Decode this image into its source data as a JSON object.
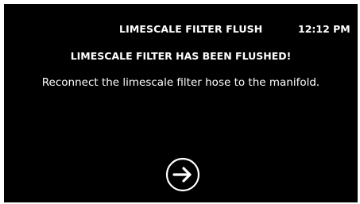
{
  "header": {
    "title": "LIMESCALE FILTER FLUSH",
    "time": "12:12 PM"
  },
  "message": {
    "heading": "LIMESCALE FILTER HAS BEEN FLUSHED!",
    "body": "Reconnect the limescale filter hose to the manifold."
  },
  "actions": {
    "next_icon": "arrow-right-circle-icon"
  },
  "colors": {
    "background": "#000000",
    "text": "#ffffff"
  }
}
